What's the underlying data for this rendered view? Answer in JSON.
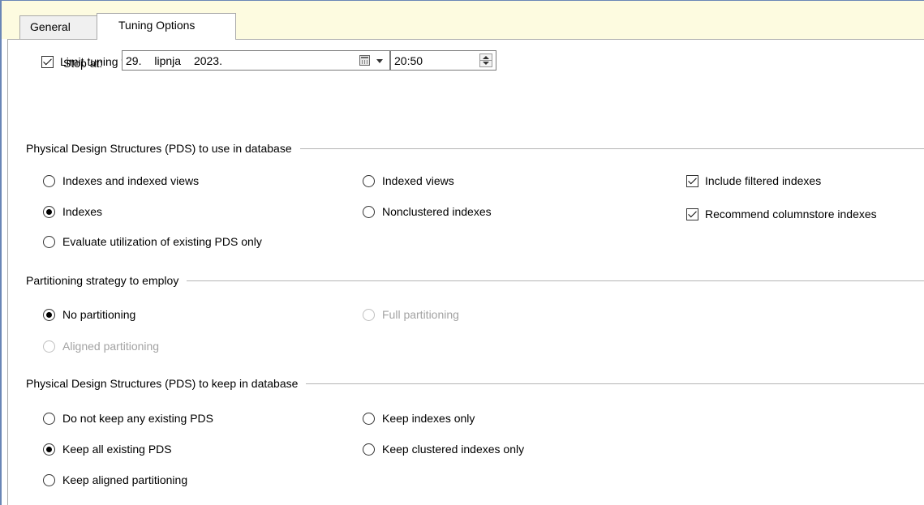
{
  "tabs": {
    "general": "General",
    "tuning": "Tuning Options"
  },
  "limit": {
    "label": "Limit tuning time",
    "checked": true
  },
  "stop": {
    "label": "Stop at:",
    "day": "29.",
    "month": "lipnja",
    "year": "2023.",
    "time": "20:50"
  },
  "pds_use": {
    "header": "Physical Design Structures (PDS) to use in database",
    "options": {
      "indexes_and_views": "Indexes and indexed views",
      "indexed_views": "Indexed views",
      "indexes": "Indexes",
      "nonclustered": "Nonclustered indexes",
      "evaluate": "Evaluate utilization of existing PDS only"
    },
    "selected": "Indexes",
    "include_filtered": "Include filtered indexes",
    "recommend_columnstore": "Recommend columnstore indexes"
  },
  "partitioning": {
    "header": "Partitioning strategy to employ",
    "options": {
      "none": "No partitioning",
      "full": "Full partitioning",
      "aligned": "Aligned partitioning"
    },
    "selected": "No partitioning"
  },
  "pds_keep": {
    "header": "Physical Design Structures (PDS) to keep in database",
    "options": {
      "none": "Do not keep any existing PDS",
      "indexes_only": "Keep indexes only",
      "all": "Keep all existing PDS",
      "clustered_only": "Keep clustered indexes only",
      "aligned": "Keep aligned partitioning"
    },
    "selected": "Keep all existing PDS"
  },
  "colors": {
    "window_border": "#6a86b6",
    "tab_strip_bg": "#fdfbe0",
    "disabled_text": "#a3a3a3"
  }
}
